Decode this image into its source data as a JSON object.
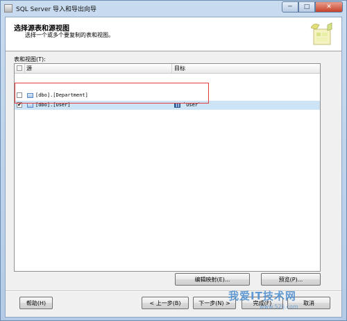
{
  "window": {
    "title": "SQL Server 导入和导出向导"
  },
  "caption_buttons": {
    "minimize": "─",
    "maximize": "□",
    "close": "✕"
  },
  "header": {
    "title": "选择源表和源视图",
    "subtitle": "选择一个或多个要复制的表和视图。"
  },
  "table_label": "表和视图(T):",
  "list": {
    "columns": {
      "source": "源",
      "target": "目标"
    },
    "rows": [
      {
        "checked": false,
        "check_glyph": "",
        "source": "[dbo].[Department]",
        "target": ""
      },
      {
        "checked": true,
        "check_glyph": "✔",
        "source": "[dbo].[User]",
        "target": "`User`"
      }
    ]
  },
  "buttons": {
    "edit_mappings": "编辑映射(E)...",
    "preview": "预览(P)...",
    "help": "帮助(H)",
    "back": "< 上一步(B)",
    "next": "下一步(N) >",
    "finish": "完成(F)",
    "cancel": "取消"
  },
  "watermark": {
    "main": "我爱IT技术网",
    "sub": "www.52ij.com"
  },
  "colors": {
    "accent": "#cde4f7",
    "highlight_border": "#e33b3b"
  }
}
